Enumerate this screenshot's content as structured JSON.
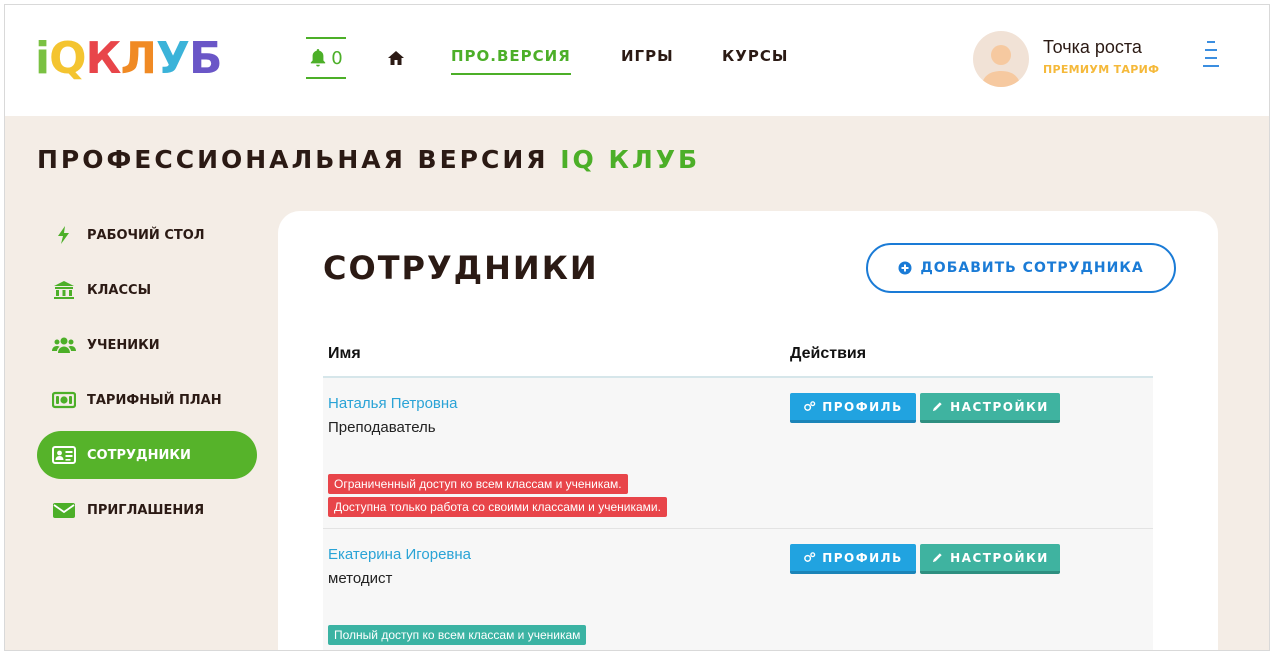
{
  "header": {
    "logo": [
      "i",
      "Q",
      "К",
      "Л",
      "У",
      "Б"
    ],
    "logo_colors": [
      "#7ac142",
      "#f4c430",
      "#e8454a",
      "#f08a24",
      "#3bb3d9",
      "#6a56c7"
    ],
    "notifications_count": "0",
    "nav": {
      "pro": "ПРО.ВЕРСИЯ",
      "games": "ИГРЫ",
      "courses": "КУРСЫ"
    },
    "user": {
      "name": "Точка роста",
      "plan": "ПРЕМИУМ ТАРИФ"
    }
  },
  "page_title": {
    "main": "ПРОФЕССИОНАЛЬНАЯ ВЕРСИЯ",
    "accent": "IQ КЛУБ"
  },
  "sidebar": {
    "items": [
      {
        "label": "РАБОЧИЙ СТОЛ",
        "icon": "bolt-icon"
      },
      {
        "label": "КЛАССЫ",
        "icon": "institution-icon"
      },
      {
        "label": "УЧЕНИКИ",
        "icon": "users-icon"
      },
      {
        "label": "ТАРИФНЫЙ ПЛАН",
        "icon": "money-icon"
      },
      {
        "label": "СОТРУДНИКИ",
        "icon": "id-card-icon",
        "active": true
      },
      {
        "label": "ПРИГЛАШЕНИЯ",
        "icon": "envelope-icon"
      }
    ]
  },
  "main": {
    "title": "СОТРУДНИКИ",
    "add_button": "ДОБАВИТЬ СОТРУДНИКА",
    "columns": [
      "Имя",
      "Действия"
    ],
    "rows": [
      {
        "name": "Наталья Петровна",
        "role": "Преподаватель",
        "tags": [
          "Ограниченный доступ ко всем классам и ученикам.",
          "Доступна только работа со своими классами и учениками."
        ],
        "tag_color": "red"
      },
      {
        "name": "Екатерина Игоревна",
        "role": "методист",
        "tags": [
          "Полный доступ ко всем классам и ученикам"
        ],
        "tag_color": "teal"
      }
    ],
    "actions": {
      "profile": "ПРОФИЛЬ",
      "settings": "НАСТРОЙКИ"
    }
  },
  "colors": {
    "brand_green": "#56b32a",
    "link_blue": "#2aa3d6",
    "accent_blue": "#1a7bd6",
    "plan_gold": "#f5b93a"
  }
}
